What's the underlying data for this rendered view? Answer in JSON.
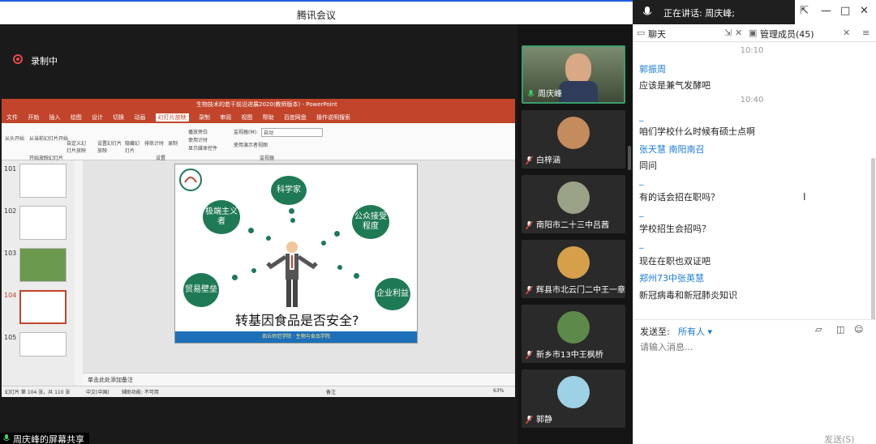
{
  "app": {
    "title": "腾讯会议",
    "speaking_label": "正在讲话: 周庆峰;"
  },
  "window_controls": {
    "pin": "⇱",
    "minimize": "—",
    "maximize": "□",
    "close": "✕"
  },
  "recording": {
    "label": "录制中"
  },
  "share": {
    "label": "周庆峰的屏幕共享"
  },
  "ppt": {
    "doc_title": "生物技术的若干前沿进展2020(教师版本) - PowerPoint",
    "tabs": [
      "文件",
      "开始",
      "插入",
      "绘图",
      "设计",
      "切换",
      "动画",
      "幻灯片放映",
      "录制",
      "审阅",
      "视图",
      "帮助",
      "百度网盘",
      "操作说明搜索"
    ],
    "active_tab": "幻灯片放映",
    "ribbon": [
      "从头开始",
      "从当前幻灯片开始",
      "自定义幻灯片放映",
      "设置幻灯片放映",
      "隐藏幻灯片",
      "排练计时",
      "录制",
      "播放旁白",
      "使用计时",
      "显示媒体控件",
      "监视器(M):",
      "自动",
      "使用演示者视图",
      "开始放映幻灯片",
      "设置",
      "监视器"
    ],
    "thumbs": [
      "101",
      "102",
      "103",
      "104",
      "105"
    ],
    "selected_thumb": "104",
    "slide": {
      "clouds": [
        "科学家",
        "极端主义者",
        "公众接受程度",
        "贸易壁垒",
        "企业利益"
      ],
      "question": "转基因食品是否安全?",
      "footer": "商丘师范学院 · 生物与食品学院"
    },
    "notes": "单击此处添加备注",
    "status": [
      "幻灯片 第 104 张，共 110 张",
      "中文(中国)",
      "辅助功能: 不可用",
      "备注",
      "63%"
    ]
  },
  "participants": [
    {
      "name": "周庆峰",
      "active": true,
      "avatar_color": "#6a7c58"
    },
    {
      "name": "白梓涵",
      "active": false,
      "avatar_color": "#c48b5c"
    },
    {
      "name": "南阳市二十三中吕茜",
      "active": false,
      "avatar_color": "#9aa287"
    },
    {
      "name": "辉县市北云门二中王一章",
      "active": false,
      "avatar_color": "#d6a04a"
    },
    {
      "name": "新乡市13中王枫桥",
      "active": false,
      "avatar_color": "#5d8a4a"
    },
    {
      "name": "郭静",
      "active": false,
      "avatar_color": "#9ed1e6"
    }
  ],
  "chat": {
    "tab_chat": "聊天",
    "tab_members": "管理成员(45)",
    "messages": [
      {
        "kind": "time",
        "text": "10:10"
      },
      {
        "kind": "sender",
        "text": "郭振周"
      },
      {
        "kind": "line",
        "text": "应该是兼气发酵吧"
      },
      {
        "kind": "time",
        "text": "10:40"
      },
      {
        "kind": "sender",
        "text": "_"
      },
      {
        "kind": "line",
        "text": "咱们学校什么时候有硕士点啊"
      },
      {
        "kind": "sender",
        "text": "张天慧  南阳南召"
      },
      {
        "kind": "line",
        "text": "同问"
      },
      {
        "kind": "sender",
        "text": "_"
      },
      {
        "kind": "line",
        "text": "有的话会招在职吗？"
      },
      {
        "kind": "sender",
        "text": "_"
      },
      {
        "kind": "line",
        "text": "学校招生会招吗？"
      },
      {
        "kind": "sender",
        "text": "_"
      },
      {
        "kind": "line",
        "text": "现在在职也双证吧"
      },
      {
        "kind": "sender",
        "text": "郑州73中张英慧"
      },
      {
        "kind": "line",
        "text": "新冠病毒和新冠肺炎知识"
      }
    ],
    "send_to_label": "发送至:",
    "send_to_value": "所有人",
    "input_placeholder": "请输入消息...",
    "send_button": "发送(S)"
  }
}
